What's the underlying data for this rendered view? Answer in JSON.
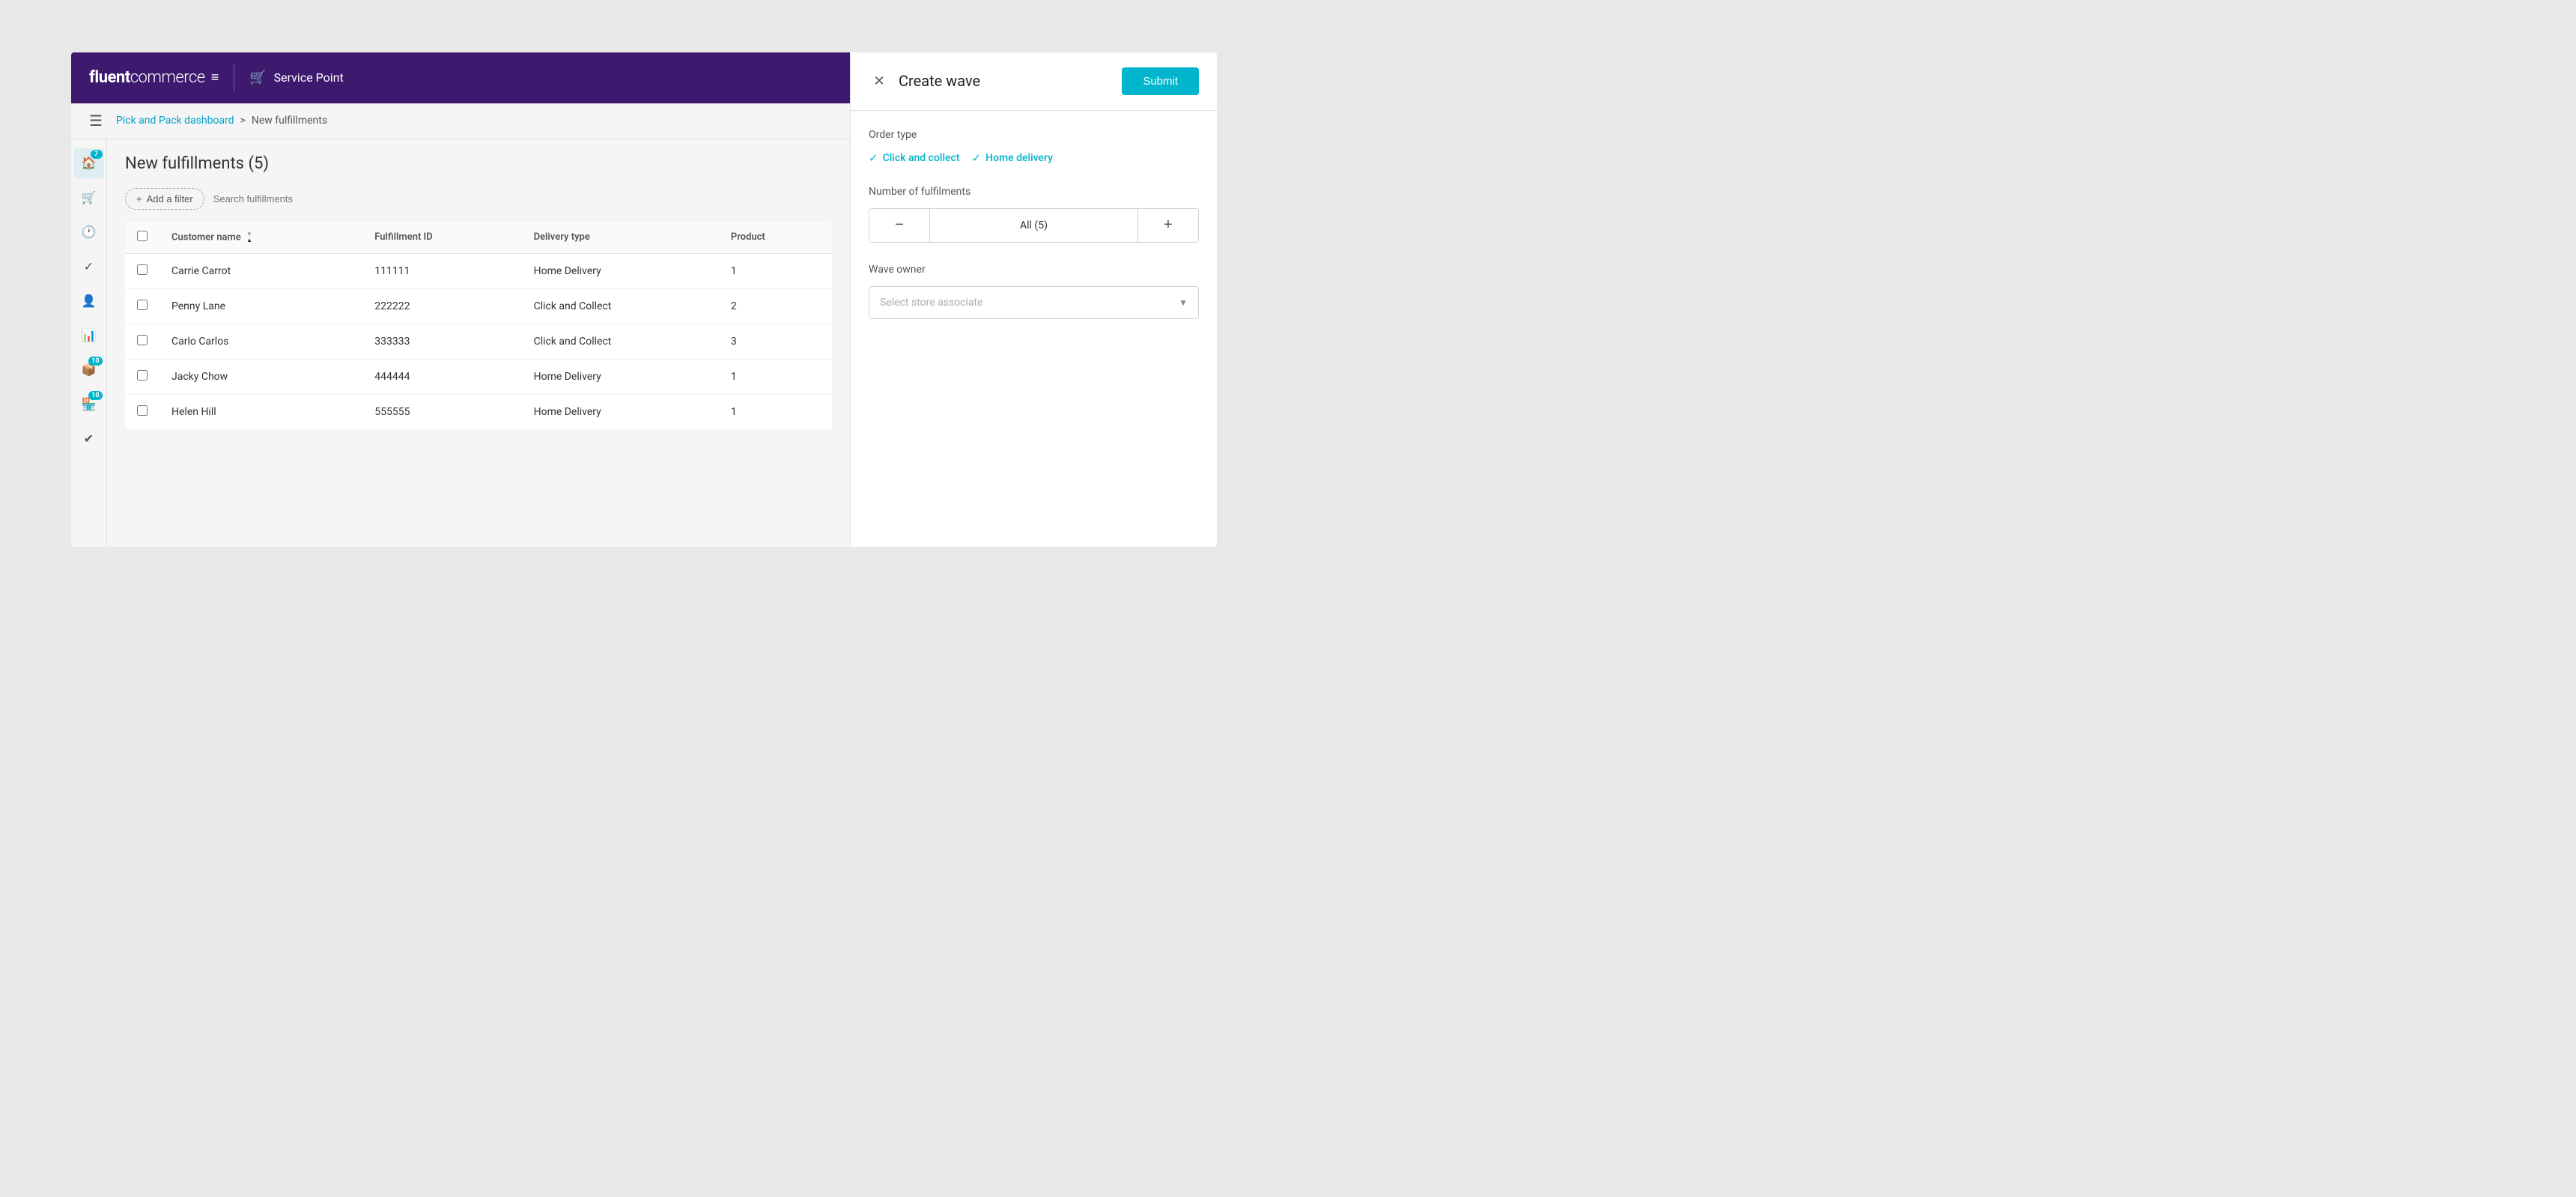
{
  "header": {
    "logo": "fluentcommerce",
    "logo_icon": "≡",
    "service_label": "Service Point"
  },
  "breadcrumb": {
    "home": "Pick and Pack dashboard",
    "separator": ">",
    "current": "New fulfillments"
  },
  "sidebar": {
    "items": [
      {
        "icon": "🏠",
        "badge": "7",
        "label": "home",
        "active": true
      },
      {
        "icon": "🛒",
        "badge": null,
        "label": "orders"
      },
      {
        "icon": "🕐",
        "badge": null,
        "label": "history"
      },
      {
        "icon": "✓",
        "badge": null,
        "label": "completed"
      },
      {
        "icon": "👤",
        "badge": null,
        "label": "users"
      },
      {
        "icon": "📊",
        "badge": null,
        "label": "reports"
      },
      {
        "icon": "📦",
        "badge": "10",
        "label": "packages"
      },
      {
        "icon": "🏪",
        "badge": "10",
        "label": "stores"
      },
      {
        "icon": "✔",
        "badge": null,
        "label": "verify"
      }
    ]
  },
  "main": {
    "page_title": "New fulfillments (5)",
    "add_filter_label": "Add a filter",
    "search_placeholder": "Search fulfillments",
    "table": {
      "columns": [
        "",
        "Customer name",
        "Fulfillment ID",
        "Delivery type",
        "Product"
      ],
      "rows": [
        {
          "id": 1,
          "customer": "Carrie Carrot",
          "fulfillment_id": "111111",
          "delivery_type": "Home Delivery",
          "products": "1"
        },
        {
          "id": 2,
          "customer": "Penny Lane",
          "fulfillment_id": "222222",
          "delivery_type": "Click and Collect",
          "products": "2"
        },
        {
          "id": 3,
          "customer": "Carlo Carlos",
          "fulfillment_id": "333333",
          "delivery_type": "Click and Collect",
          "products": "3"
        },
        {
          "id": 4,
          "customer": "Jacky Chow",
          "fulfillment_id": "444444",
          "delivery_type": "Home Delivery",
          "products": "1"
        },
        {
          "id": 5,
          "customer": "Helen Hill",
          "fulfillment_id": "555555",
          "delivery_type": "Home Delivery",
          "products": "1"
        }
      ]
    }
  },
  "panel": {
    "title": "Create wave",
    "submit_label": "Submit",
    "order_type": {
      "label": "Order type",
      "options": [
        {
          "id": "click_collect",
          "label": "Click and collect",
          "checked": true
        },
        {
          "id": "home_delivery",
          "label": "Home delivery",
          "checked": true
        }
      ]
    },
    "num_fulfillments": {
      "label": "Number of fulfilments",
      "minus_label": "−",
      "value_label": "All (5)",
      "plus_label": "+"
    },
    "wave_owner": {
      "label": "Wave owner",
      "placeholder": "Select store associate"
    }
  },
  "colors": {
    "header_bg": "#3d1a6e",
    "accent": "#00b5cc",
    "link": "#00a0c6"
  }
}
